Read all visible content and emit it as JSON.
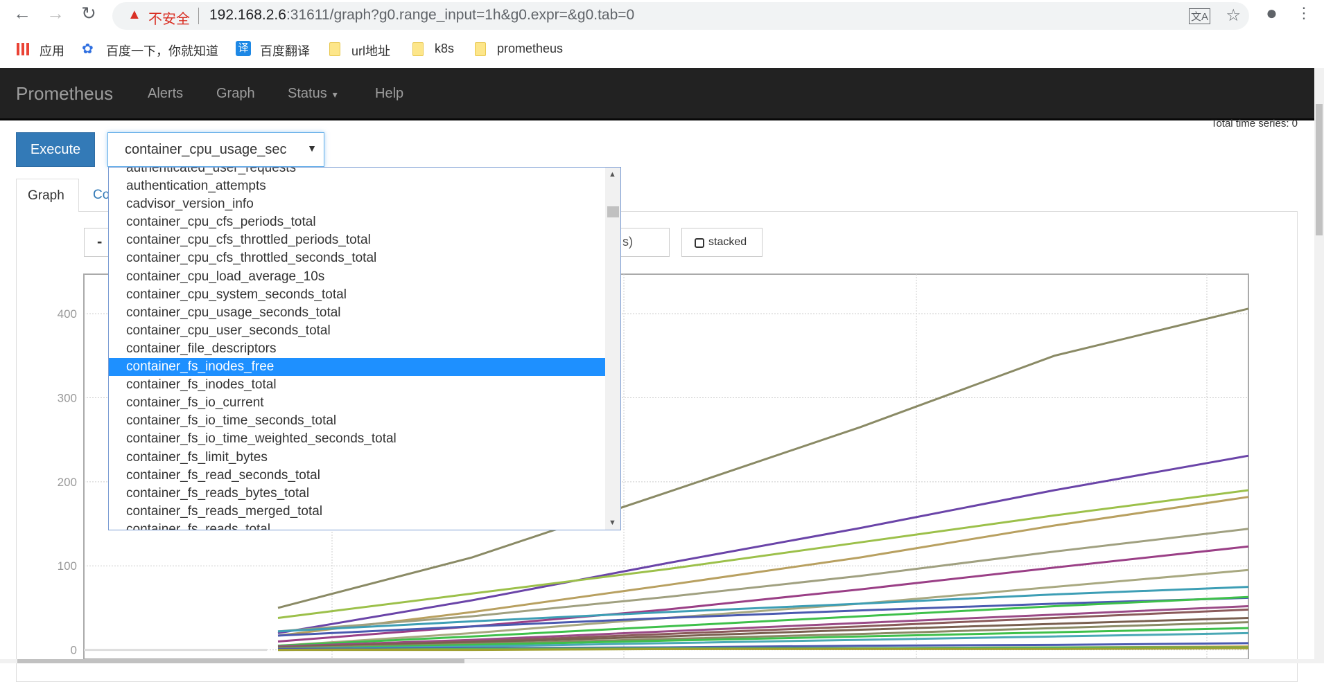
{
  "browser": {
    "security_label": "不安全",
    "url_host": "192.168.2.6",
    "url_rest": ":31611/graph?g0.range_input=1h&g0.expr=&g0.tab=0",
    "bookmarks": [
      {
        "label": "应用",
        "icon": "apps-grid-icon"
      },
      {
        "label": "百度一下，你就知道",
        "icon": "baidu-paw-icon"
      },
      {
        "label": "百度翻译",
        "icon": "translate-icon"
      },
      {
        "label": "url地址",
        "icon": "folder-icon"
      },
      {
        "label": "k8s",
        "icon": "folder-icon"
      },
      {
        "label": "prometheus",
        "icon": "folder-icon"
      }
    ],
    "translate_icon_glyph": "文A"
  },
  "navbar": {
    "brand": "Prometheus",
    "links": [
      "Alerts",
      "Graph",
      "Status",
      "Help"
    ]
  },
  "query": {
    "execute_label": "Execute",
    "selected_metric": "container_cpu_usage_sec",
    "total_series": "Total time series: 0"
  },
  "tabs": {
    "graph": "Graph",
    "console_partial": "Co"
  },
  "controls": {
    "minus": "-",
    "range_tail": "s)",
    "stacked": "stacked"
  },
  "dropdown": {
    "selected_index": 11,
    "items": [
      "authenticated_user_requests",
      "authentication_attempts",
      "cadvisor_version_info",
      "container_cpu_cfs_periods_total",
      "container_cpu_cfs_throttled_periods_total",
      "container_cpu_cfs_throttled_seconds_total",
      "container_cpu_load_average_10s",
      "container_cpu_system_seconds_total",
      "container_cpu_usage_seconds_total",
      "container_cpu_user_seconds_total",
      "container_file_descriptors",
      "container_fs_inodes_free",
      "container_fs_inodes_total",
      "container_fs_io_current",
      "container_fs_io_time_seconds_total",
      "container_fs_io_time_weighted_seconds_total",
      "container_fs_limit_bytes",
      "container_fs_read_seconds_total",
      "container_fs_reads_bytes_total",
      "container_fs_reads_merged_total",
      "container_fs_reads_total"
    ]
  },
  "chart_data": {
    "type": "line",
    "yticks": [
      "0",
      "100",
      "200",
      "300",
      "400"
    ],
    "ylim": [
      -11,
      447
    ],
    "grid": true,
    "series": [
      {
        "color": "#8a8a65",
        "values": [
          null,
          50,
          110,
          187,
          265,
          350,
          406
        ]
      },
      {
        "color": "#6a44a8",
        "values": [
          null,
          20,
          59,
          103,
          145,
          190,
          231
        ]
      },
      {
        "color": "#9cc04a",
        "values": [
          null,
          38,
          67,
          96,
          128,
          160,
          190
        ]
      },
      {
        "color": "#b8a060",
        "values": [
          null,
          17,
          45,
          77,
          110,
          148,
          182
        ]
      },
      {
        "color": "#a0a080",
        "values": [
          null,
          22,
          40,
          63,
          88,
          117,
          144
        ]
      },
      {
        "color": "#9a3f86",
        "values": [
          null,
          10,
          28,
          48,
          72,
          98,
          123
        ]
      },
      {
        "color": "#a8a880",
        "values": [
          null,
          5,
          20,
          38,
          55,
          75,
          95
        ]
      },
      {
        "color": "#3d9eb5",
        "values": [
          null,
          22,
          34,
          45,
          55,
          66,
          75
        ]
      },
      {
        "color": "#4a5ab0",
        "values": [
          null,
          17,
          28,
          38,
          47,
          55,
          62
        ]
      },
      {
        "color": "#3ec04a",
        "values": [
          null,
          5,
          16,
          28,
          40,
          52,
          63
        ]
      },
      {
        "color": "#9a4a86",
        "values": [
          null,
          4,
          12,
          22,
          32,
          42,
          52
        ]
      },
      {
        "color": "#8a5a5a",
        "values": [
          null,
          3,
          10,
          19,
          28,
          38,
          48
        ]
      },
      {
        "color": "#7a6050",
        "values": [
          null,
          3,
          9,
          16,
          24,
          31,
          38
        ]
      },
      {
        "color": "#8a8a65",
        "values": [
          null,
          2,
          7,
          13,
          19,
          26,
          33
        ]
      },
      {
        "color": "#3ec04a",
        "values": [
          null,
          1,
          6,
          11,
          16,
          21,
          26
        ]
      },
      {
        "color": "#4aa8b5",
        "values": [
          null,
          1,
          4,
          8,
          12,
          16,
          20
        ]
      },
      {
        "color": "#4a5ab0",
        "values": [
          null,
          1,
          2,
          3,
          5,
          6,
          8
        ]
      },
      {
        "color": "#d09a30",
        "values": [
          null,
          0,
          1,
          1,
          2,
          3,
          4
        ]
      },
      {
        "color": "#5ab05a",
        "values": [
          null,
          0,
          1,
          2,
          2,
          3,
          3
        ]
      },
      {
        "color": "#a0a030",
        "values": [
          null,
          0,
          0,
          1,
          1,
          1,
          2
        ]
      }
    ]
  }
}
